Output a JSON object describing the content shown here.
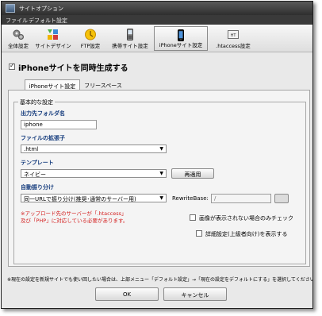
{
  "window": {
    "title": "サイトオプション"
  },
  "menu": [
    "ファイル",
    "デフォルト設定"
  ],
  "toolbar": {
    "items": [
      {
        "label": "全体設定",
        "icon": "gear-icon"
      },
      {
        "label": "サイトデザイン",
        "icon": "design-icon"
      },
      {
        "label": "FTP設定",
        "icon": "ftp-icon"
      },
      {
        "label": "携帯サイト設定",
        "icon": "mobile-icon"
      },
      {
        "label": "iPhoneサイト設定",
        "icon": "iphone-icon",
        "active": true
      },
      {
        "label": ".htaccess設定",
        "icon": "htaccess-icon"
      }
    ]
  },
  "main_checkbox": {
    "label": "iPhoneサイトを同時生成する",
    "checked": true
  },
  "tabs": [
    {
      "label": "iPhoneサイト設定",
      "active": true
    },
    {
      "label": "フリースペース",
      "active": false
    }
  ],
  "group": {
    "legend": "基本的な設定"
  },
  "output_folder": {
    "label": "出力先フォルダ名",
    "value": "iphone"
  },
  "file_ext": {
    "label": "ファイルの拡張子",
    "value": ".html"
  },
  "template": {
    "label": "テンプレート",
    "value": "ネイビー",
    "reapply_label": "再適用"
  },
  "auto_sort": {
    "label": "自動振り分け",
    "value": "同一URLで振り分け(推奨･通常のサーバー用)",
    "rewrite_label": "RewriteBase:",
    "rewrite_value": "/",
    "note_line1": "※アップロード先のサーバーが「.htaccess」",
    "note_line2": "及び「PHP」に対応している必要があります。",
    "image_check_label": "画像が表示されない場合のみチェック"
  },
  "advanced_checkbox": {
    "label": "詳細設定(上級者向け)を表示する",
    "checked": false
  },
  "bottom_note": "※現在の設定を新規サイトでも使い回したい場合は、上部メニュー「デフォルト設定」→「現在の設定をデフォルトにする」を選択してください。",
  "buttons": {
    "ok": "OK",
    "cancel": "キャンセル"
  }
}
